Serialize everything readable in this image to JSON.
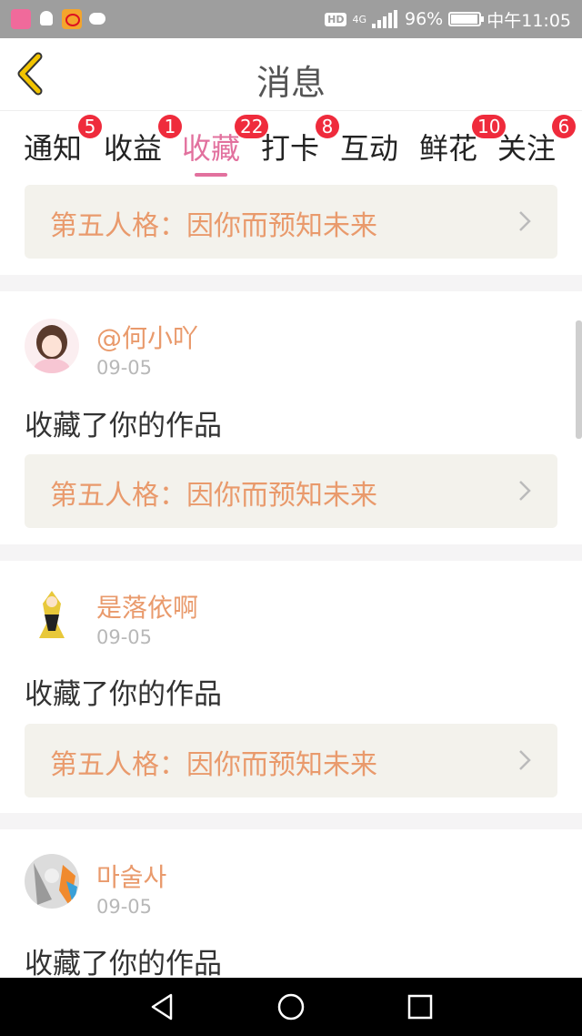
{
  "status_bar": {
    "hd": "HD",
    "network": "4G",
    "battery_percent": "96%",
    "battery_level": 0.96,
    "time": "中午11:05",
    "icons": [
      "app-notification-icon",
      "qq-icon",
      "weibo-icon",
      "message-icon",
      "signal-icon",
      "battery-icon"
    ]
  },
  "header": {
    "title": "消息",
    "back_icon": "chevron-left-icon"
  },
  "tabs": [
    {
      "label": "通知",
      "badge": "5"
    },
    {
      "label": "收益",
      "badge": "1"
    },
    {
      "label": "收藏",
      "badge": "22",
      "active": true
    },
    {
      "label": "打卡",
      "badge": "8"
    },
    {
      "label": "互动",
      "badge": ""
    },
    {
      "label": "鲜花",
      "badge": "10"
    },
    {
      "label": "关注",
      "badge": "6"
    }
  ],
  "top_card": {
    "title": "第五人格：因你而预知未来"
  },
  "items": [
    {
      "user": "@何小吖",
      "date": "09-05",
      "action": "收藏了你的作品",
      "work": "第五人格：因你而预知未来"
    },
    {
      "user": "是落依啊",
      "date": "09-05",
      "action": "收藏了你的作品",
      "work": "第五人格：因你而预知未来"
    },
    {
      "user": "마술사",
      "date": "09-05",
      "action": "收藏了你的作品",
      "work": ""
    }
  ],
  "colors": {
    "accent_pink": "#e2719e",
    "username_orange": "#e99a6c",
    "badge_red": "#ef2b3c",
    "card_bg": "#f3f2ec",
    "back_yellow": "#f2c400"
  },
  "nav": {
    "icons": [
      "back-triangle-icon",
      "home-circle-icon",
      "recents-square-icon"
    ]
  }
}
